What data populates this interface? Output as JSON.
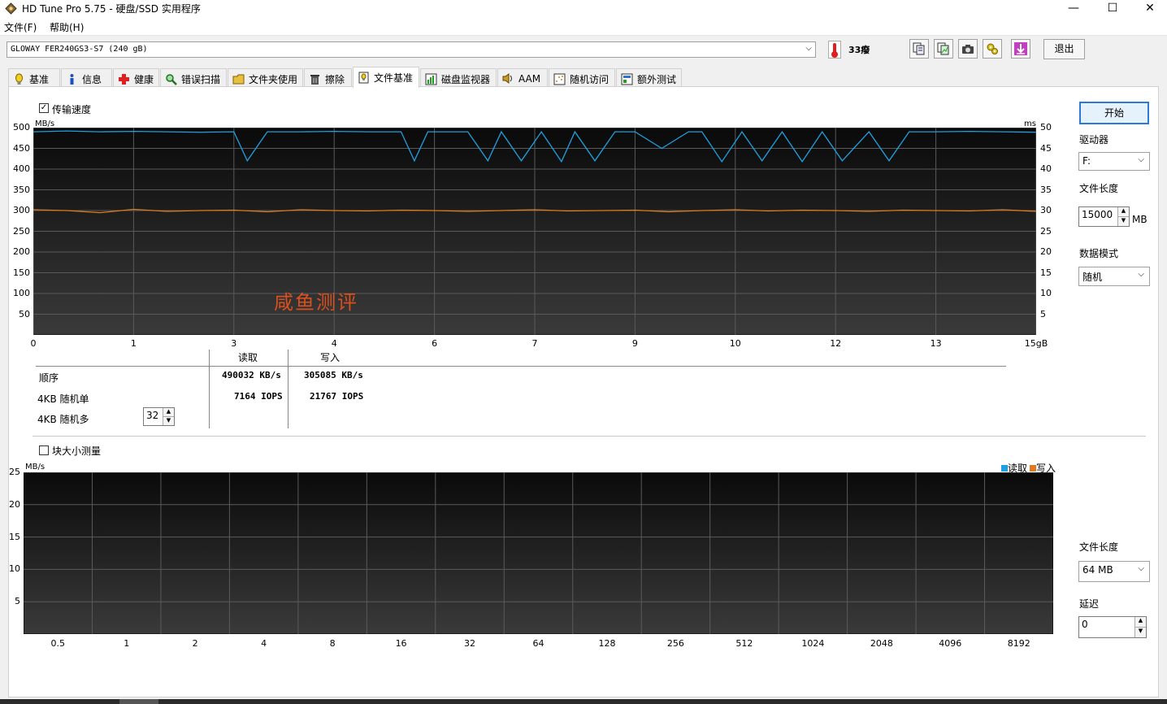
{
  "window": {
    "title": "HD Tune Pro 5.75 - 硬盘/SSD 实用程序",
    "minimize": "—",
    "maximize": "☐",
    "close": "✕"
  },
  "menu": {
    "file": "文件(F)",
    "help": "帮助(H)"
  },
  "drive": {
    "name": "GLOWAY FER240GS3-S7 (240 gB)"
  },
  "temperature": "33癈",
  "exit_label": "退出",
  "tabs": [
    {
      "label": "基准",
      "icon": "bulb-icon"
    },
    {
      "label": "信息",
      "icon": "info-icon"
    },
    {
      "label": "健康",
      "icon": "health-cross-icon"
    },
    {
      "label": "错误扫描",
      "icon": "magnifier-icon"
    },
    {
      "label": "文件夹使用",
      "icon": "folder-icon"
    },
    {
      "label": "擦除",
      "icon": "trash-icon"
    },
    {
      "label": "文件基准",
      "icon": "file-benchmark-icon"
    },
    {
      "label": "磁盘监视器",
      "icon": "monitor-chart-icon"
    },
    {
      "label": "AAM",
      "icon": "speaker-icon"
    },
    {
      "label": "随机访问",
      "icon": "random-access-icon"
    },
    {
      "label": "额外测试",
      "icon": "extra-tests-icon"
    }
  ],
  "active_tab": "文件基准",
  "transfer": {
    "checkbox_label": "传输速度",
    "checked": true,
    "y_unit_left": "MB/s",
    "y_unit_right": "ms",
    "watermark": "咸鱼测评"
  },
  "results": {
    "col_read": "读取",
    "col_write": "写入",
    "rows": [
      {
        "label": "顺序",
        "read": "490032 KB/s",
        "write": "305085 KB/s"
      },
      {
        "label": "4KB 随机单",
        "read": "7164 IOPS",
        "write": "21767 IOPS"
      },
      {
        "label": "4KB 随机多",
        "read": "",
        "write": ""
      }
    ],
    "queue_depth": "32"
  },
  "block": {
    "checkbox_label": "块大小测量",
    "checked": false,
    "y_unit": "MB/s",
    "legend_read": "读取",
    "legend_write": "写入"
  },
  "side": {
    "start": "开始",
    "drive_label": "驱动器",
    "drive_value": "F:",
    "file_length_label": "文件长度",
    "file_length_value": "15000",
    "file_length_unit": "MB",
    "data_mode_label": "数据模式",
    "data_mode_value": "随机",
    "file_length2_label": "文件长度",
    "file_length2_value": "64 MB",
    "delay_label": "延迟",
    "delay_value": "0"
  },
  "colors": {
    "read": "#1ea0e0",
    "write": "#e07a1e",
    "plot_bg": "#2a2a2a",
    "grid": "#5a5a5a"
  },
  "chart_data": [
    {
      "type": "line",
      "title": "",
      "xlabel": "",
      "ylabel": "MB/s",
      "y2label": "ms",
      "x_ticks": [
        "0",
        "1",
        "3",
        "4",
        "6",
        "7",
        "9",
        "10",
        "12",
        "13",
        "15gB"
      ],
      "y_ticks": [
        500,
        450,
        400,
        350,
        300,
        250,
        200,
        150,
        100,
        50
      ],
      "y2_ticks": [
        50,
        45,
        40,
        35,
        30,
        25,
        20,
        15,
        10,
        5
      ],
      "xlim": [
        0,
        15
      ],
      "ylim": [
        0,
        500
      ],
      "series": [
        {
          "name": "读取",
          "x": [
            0,
            0.5,
            1.0,
            1.5,
            2.0,
            2.5,
            3.0,
            3.2,
            3.5,
            4.0,
            4.5,
            5.0,
            5.5,
            5.7,
            5.9,
            6.0,
            6.5,
            6.8,
            7.0,
            7.3,
            7.6,
            7.9,
            8.1,
            8.4,
            8.7,
            9.0,
            9.4,
            9.8,
            10.0,
            10.3,
            10.6,
            10.9,
            11.2,
            11.5,
            11.8,
            12.1,
            12.5,
            12.8,
            13.1,
            13.5,
            14.0,
            14.5,
            15.0
          ],
          "values": [
            490,
            492,
            490,
            491,
            490,
            489,
            490,
            420,
            490,
            490,
            491,
            490,
            490,
            420,
            490,
            490,
            490,
            420,
            490,
            420,
            490,
            418,
            490,
            420,
            490,
            490,
            450,
            490,
            490,
            418,
            490,
            420,
            490,
            418,
            490,
            420,
            490,
            420,
            490,
            490,
            491,
            490,
            489
          ]
        },
        {
          "name": "写入",
          "x": [
            0,
            0.5,
            1.0,
            1.5,
            2.0,
            2.5,
            3.0,
            3.5,
            4.0,
            4.5,
            5.0,
            5.5,
            6.0,
            6.5,
            7.0,
            7.5,
            8.0,
            8.5,
            9.0,
            9.5,
            10.0,
            10.5,
            11.0,
            11.5,
            12.0,
            12.5,
            13.0,
            13.5,
            14.0,
            14.5,
            15.0
          ],
          "values": [
            302,
            300,
            295,
            303,
            298,
            300,
            301,
            297,
            302,
            300,
            299,
            301,
            300,
            298,
            300,
            302,
            299,
            300,
            301,
            297,
            300,
            302,
            299,
            301,
            300,
            298,
            301,
            300,
            299,
            302,
            298
          ]
        }
      ]
    },
    {
      "type": "bar",
      "title": "",
      "xlabel": "",
      "ylabel": "MB/s",
      "categories": [
        "0.5",
        "1",
        "2",
        "4",
        "8",
        "16",
        "32",
        "64",
        "128",
        "256",
        "512",
        "1024",
        "2048",
        "4096",
        "8192"
      ],
      "y_ticks": [
        25,
        20,
        15,
        10,
        5
      ],
      "ylim": [
        0,
        25
      ],
      "series": [
        {
          "name": "读取",
          "values": []
        },
        {
          "name": "写入",
          "values": []
        }
      ]
    }
  ]
}
